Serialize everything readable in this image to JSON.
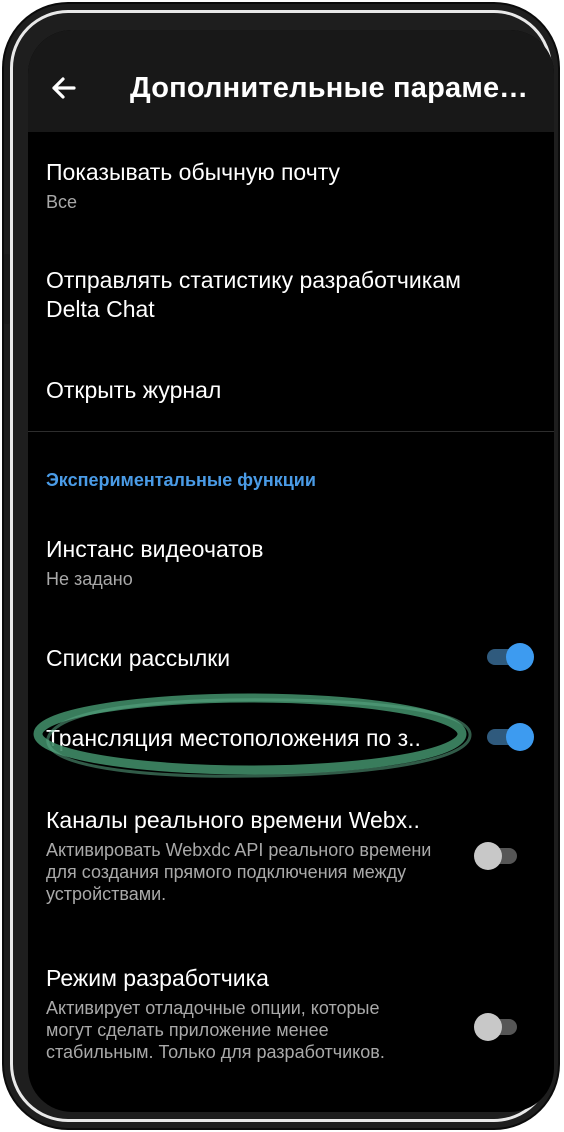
{
  "app_bar": {
    "back_icon": "arrow-left-icon",
    "title": "Дополнительные парамет…"
  },
  "preferences": [
    {
      "title": "Показывать обычную почту",
      "summary": "Все"
    },
    {
      "title": "Отправлять статистику разработчикам Delta Chat"
    },
    {
      "title": "Открыть журнал"
    }
  ],
  "experimental": {
    "header": "Экспериментальные функции",
    "items": [
      {
        "title": "Инстанс видеочатов",
        "summary": "Не задано"
      },
      {
        "title": "Списки рассылки",
        "switch": "on"
      },
      {
        "title": "Трансляция местоположения по з..",
        "switch": "on"
      },
      {
        "title": "Каналы реального времени Webx..",
        "summary": "Активировать Webxdc API реального времени для создания прямого подключения между устройствами.",
        "switch": "off"
      },
      {
        "title": "Режим разработчика",
        "summary": "Активирует отладочные опции, которые могут сделать приложение менее стабильным. Только для разработчиков.",
        "switch": "off"
      }
    ]
  },
  "colors": {
    "background": "#000000",
    "app_bar": "#181818",
    "accent": "#4a9be6",
    "switch_on_thumb": "#3d9bf0",
    "switch_off_thumb": "#c8c8c8",
    "highlight_ellipse": "#3f8a66"
  }
}
